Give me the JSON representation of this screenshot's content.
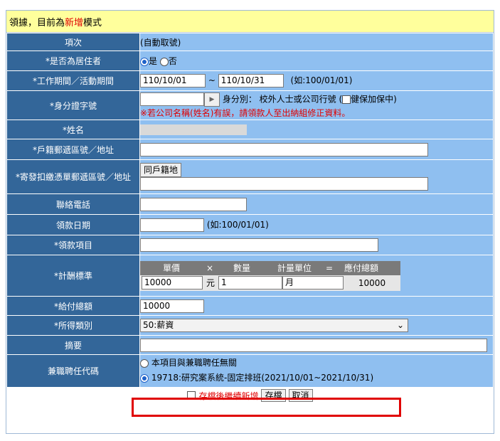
{
  "header": {
    "prefix": "領據，目前為",
    "mode": "新增",
    "suffix": "模式"
  },
  "rows": {
    "item_no": {
      "label": "項次",
      "value": "(自動取號)"
    },
    "resident": {
      "label": "*是否為居住者",
      "yes": "是",
      "no": "否"
    },
    "period": {
      "label": "*工作期間／活動期間",
      "start": "110/10/01",
      "sep": "~",
      "end": "110/10/31",
      "hint": "(如:100/01/01)"
    },
    "id_number": {
      "label": "*身分證字號",
      "identity": "身分別：",
      "identity_value": "校外人士或公司行號 (",
      "insurance": "健保加保中)",
      "warning": "※若公司名稱(姓名)有誤，請領款人至出納組修正資料。"
    },
    "name": {
      "label": "*姓名"
    },
    "address": {
      "label": "*戶籍郵遞區號／地址"
    },
    "mail_address": {
      "label": "*寄發扣繳憑單郵遞區號／地址",
      "same_button": "同戶籍地"
    },
    "phone": {
      "label": "聯絡電話"
    },
    "receive_date": {
      "label": "領款日期",
      "hint": "(如:100/01/01)"
    },
    "receive_item": {
      "label": "*領款項目"
    },
    "calc": {
      "label": "*計酬標準",
      "unit_price": "單價",
      "times": "×",
      "quantity": "數量",
      "measure_unit": "計量單位",
      "equals": "=",
      "total_due": "應付總額",
      "price_value": "10000",
      "currency": "元",
      "qty_value": "1",
      "unit_value": "月",
      "total_value": "10000"
    },
    "total_pay": {
      "label": "*給付總額",
      "value": "10000"
    },
    "income_type": {
      "label": "*所得類別",
      "value": "50:薪資"
    },
    "summary": {
      "label": "摘要"
    },
    "position": {
      "label": "兼職聘任代碼",
      "option1": "本項目與兼職聘任無關",
      "option2": "19718:研究案系統-固定排班(2021/10/01~2021/10/31)"
    }
  },
  "footer": {
    "continue_label": "存檔後繼續新增",
    "save": "存檔",
    "cancel": "取消"
  }
}
